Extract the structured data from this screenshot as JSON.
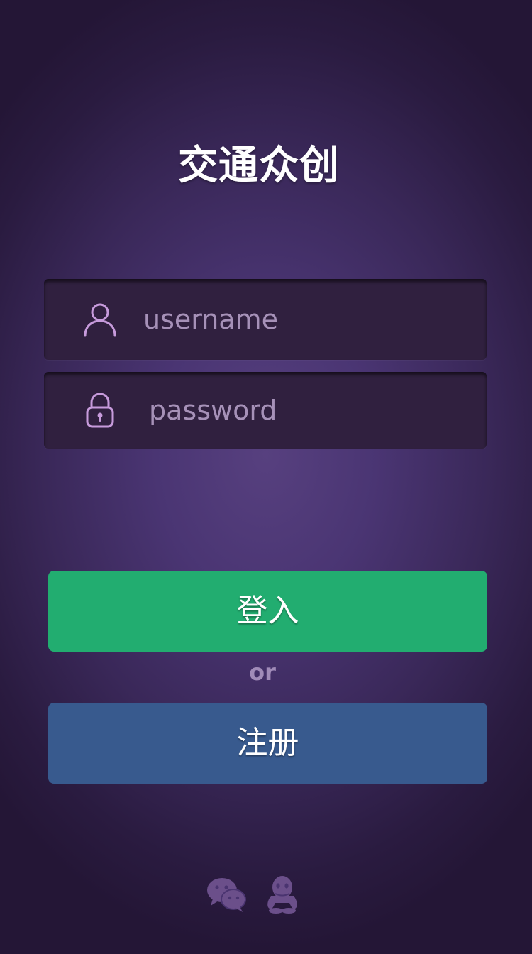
{
  "app": {
    "title": "交通众创"
  },
  "form": {
    "username_placeholder": "username",
    "username_value": "",
    "password_placeholder": "password",
    "password_value": ""
  },
  "buttons": {
    "login_label": "登入",
    "separator": "or",
    "register_label": "注册"
  },
  "social": {
    "items": [
      {
        "icon": "wechat-icon"
      },
      {
        "icon": "qq-icon"
      }
    ]
  },
  "colors": {
    "login": "#22ad70",
    "register": "#385a8e",
    "field_bg": "#30203f",
    "icon_accent": "#c79bdc"
  }
}
